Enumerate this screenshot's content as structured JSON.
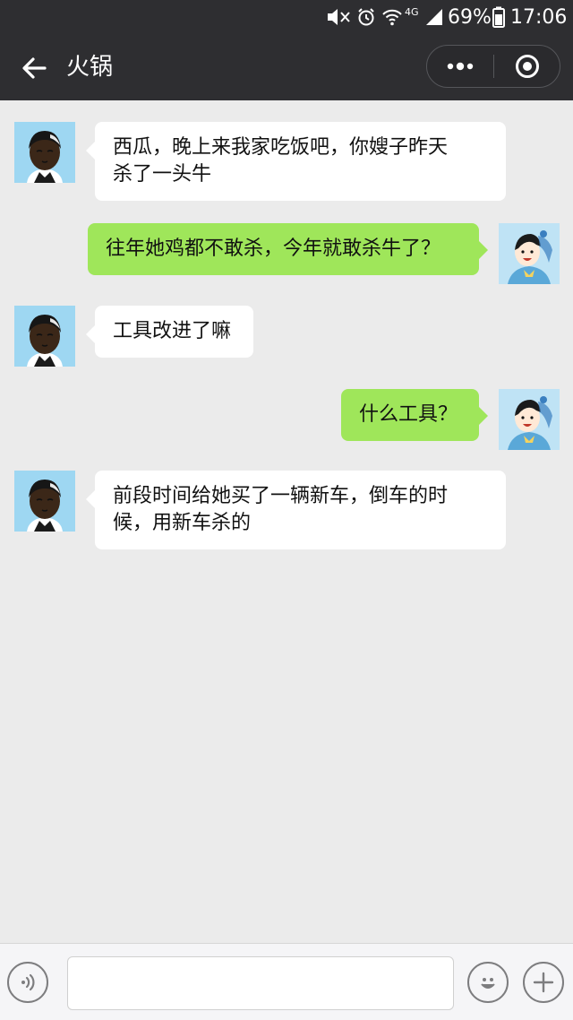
{
  "status_bar": {
    "battery": "69%",
    "time": "17:06",
    "network": "4G"
  },
  "header": {
    "title": "火锅",
    "back_icon": "arrow-left-icon",
    "more_icon": "more-dots-icon",
    "close_icon": "target-circle-icon"
  },
  "messages": [
    {
      "side": "left",
      "sender": "friend",
      "text_lines": [
        "西瓜，晚上来我家吃饭吧，你嫂子昨天",
        "杀了一头牛"
      ]
    },
    {
      "side": "right",
      "sender": "me",
      "text_lines": [
        "往年她鸡都不敢杀，今年就敢杀牛了？"
      ]
    },
    {
      "side": "left",
      "sender": "friend",
      "text_lines": [
        "工具改进了嘛"
      ]
    },
    {
      "side": "right",
      "sender": "me",
      "text_lines": [
        "什么工具？"
      ]
    },
    {
      "side": "left",
      "sender": "friend",
      "text_lines": [
        "前段时间给她买了一辆新车，倒车的时",
        "候，用新车杀的"
      ]
    }
  ],
  "input_bar": {
    "value": "",
    "voice_icon": "voice-icon",
    "emoji_icon": "emoji-icon",
    "plus_icon": "plus-icon"
  },
  "colors": {
    "header_bg": "#2e2e31",
    "chat_bg": "#ebebeb",
    "my_bubble": "#9fe65a",
    "their_bubble": "#ffffff"
  }
}
